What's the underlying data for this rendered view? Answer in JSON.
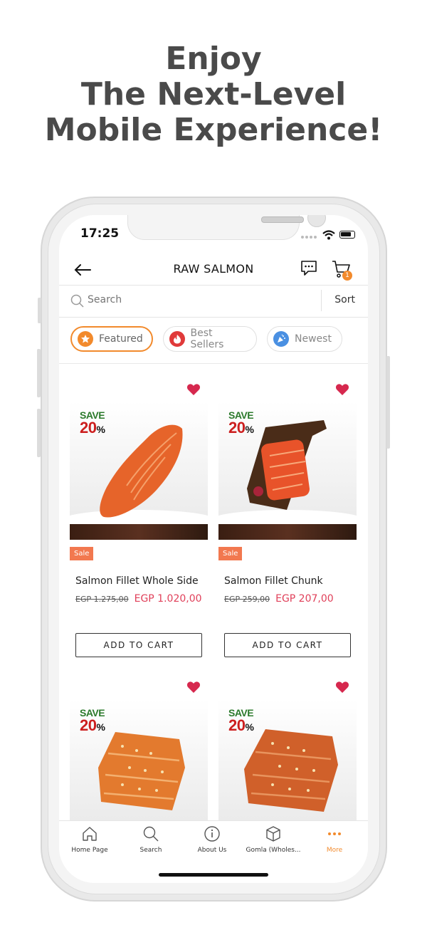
{
  "headline": {
    "line1": "Enjoy",
    "line2": "The Next-Level",
    "line3": "Mobile Experience!"
  },
  "status": {
    "time": "17:25"
  },
  "header": {
    "title": "RAW SALMON",
    "cart_count": "1"
  },
  "search": {
    "placeholder": "Search",
    "sort_label": "Sort"
  },
  "filters": [
    {
      "label": "Featured",
      "icon": "star-icon",
      "color": "#f28a2c"
    },
    {
      "label": "Best Sellers",
      "icon": "flame-icon",
      "color": "#e03a3a"
    },
    {
      "label": "Newest",
      "icon": "party-icon",
      "color": "#4a90e2"
    }
  ],
  "products": [
    {
      "save": "SAVE",
      "pct": "20",
      "pct_sign": "%",
      "sale": "Sale",
      "name": "Salmon Fillet Whole Side",
      "old_price": "EGP 1.275,00",
      "price": "EGP 1.020,00",
      "button": "ADD TO CART"
    },
    {
      "save": "SAVE",
      "pct": "20",
      "pct_sign": "%",
      "sale": "Sale",
      "name": "Salmon Fillet Chunk",
      "old_price": "EGP 259,00",
      "price": "EGP 207,00",
      "button": "ADD TO CART"
    },
    {
      "save": "SAVE",
      "pct": "20",
      "pct_sign": "%"
    },
    {
      "save": "SAVE",
      "pct": "20",
      "pct_sign": "%"
    }
  ],
  "tabbar": [
    {
      "label": "Home Page",
      "icon": "home-icon"
    },
    {
      "label": "Search",
      "icon": "search-icon"
    },
    {
      "label": "About Us",
      "icon": "info-icon"
    },
    {
      "label": "Gomla (Wholes...",
      "icon": "box-icon"
    },
    {
      "label": "More",
      "icon": "more-icon"
    }
  ],
  "colors": {
    "accent": "#f28a2c",
    "price": "#e0405a",
    "heart": "#d6284e",
    "sale": "#f2784f"
  }
}
